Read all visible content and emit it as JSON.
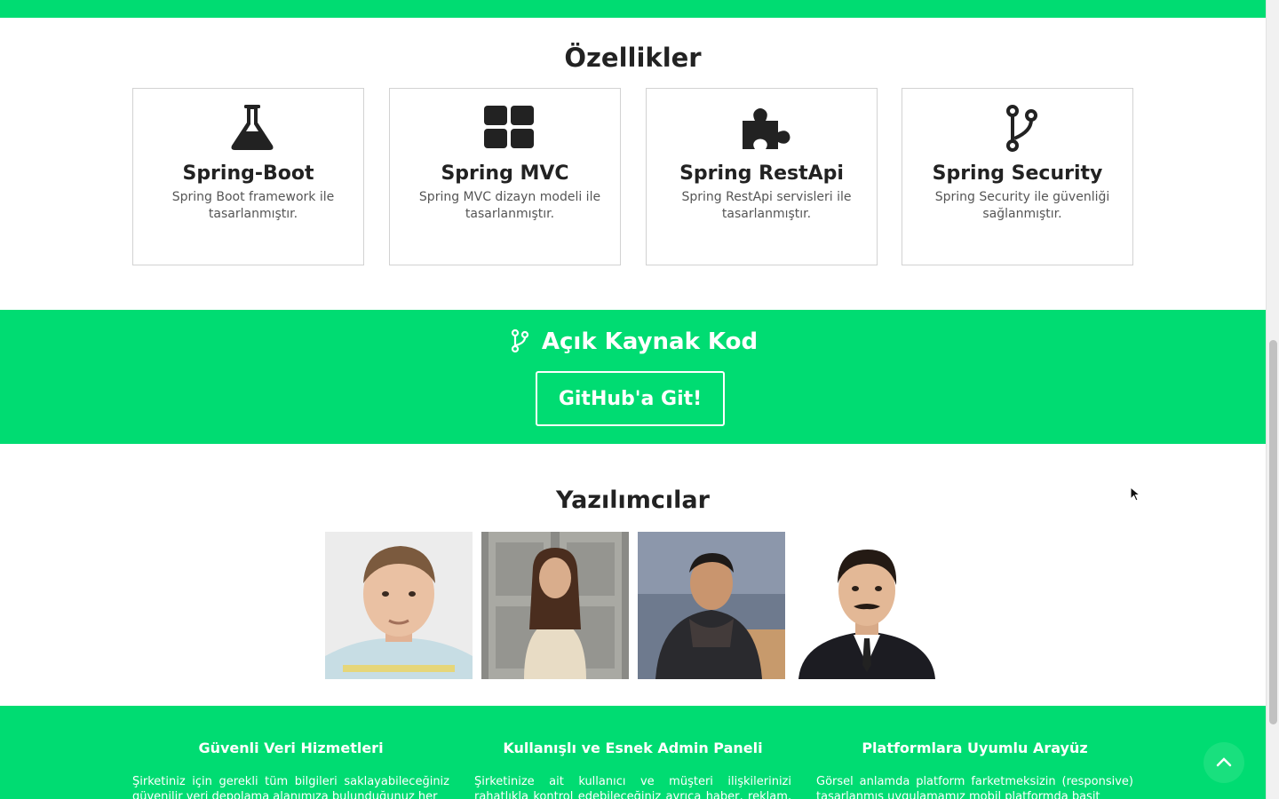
{
  "features": {
    "title": "Özellikler",
    "cards": [
      {
        "icon": "flask-icon",
        "title": "Spring-Boot",
        "desc": "Spring Boot framework ile tasarlanmıştır."
      },
      {
        "icon": "grid-icon",
        "title": "Spring MVC",
        "desc": "Spring MVC dizayn modeli ile tasarlanmıştır."
      },
      {
        "icon": "puzzle-icon",
        "title": "Spring RestApi",
        "desc": "Spring RestApi servisleri ile tasarlanmıştır."
      },
      {
        "icon": "branch-icon",
        "title": "Spring Security",
        "desc": "Spring Security ile güvenliği sağlanmıştır."
      }
    ]
  },
  "open_source": {
    "icon": "branch-icon",
    "title": "Açık Kaynak Kod",
    "button_label": "GitHub'a Git!"
  },
  "developers": {
    "title": "Yazılımcılar",
    "photos": [
      "developer-photo",
      "developer-photo",
      "developer-photo",
      "developer-photo"
    ]
  },
  "footer": {
    "columns": [
      {
        "title": "Güvenli Veri Hizmetleri",
        "text": "Şirketiniz için gerekli tüm bilgileri saklayabileceğiniz güvenilir veri depolama alanımıza bulunduğunuz her"
      },
      {
        "title": "Kullanışlı ve Esnek Admin Paneli",
        "text": "Şirketinize ait kullanıcı ve müşteri ilişkilerinizi rahatlıkla kontrol edebileceğiniz ayrıca haber, reklam, ürün"
      },
      {
        "title": "Platformlara Uyumlu Arayüz",
        "text": "Görsel anlamda platform farketmeksizin (responsive) tasarlanmış uygulamamız mobil platformda basit"
      }
    ]
  },
  "colors": {
    "brand_green": "#00dc72",
    "text_dark": "#222222",
    "card_border": "#d2d2d2"
  },
  "scroll_to_top_icon": "chevron-up-icon"
}
